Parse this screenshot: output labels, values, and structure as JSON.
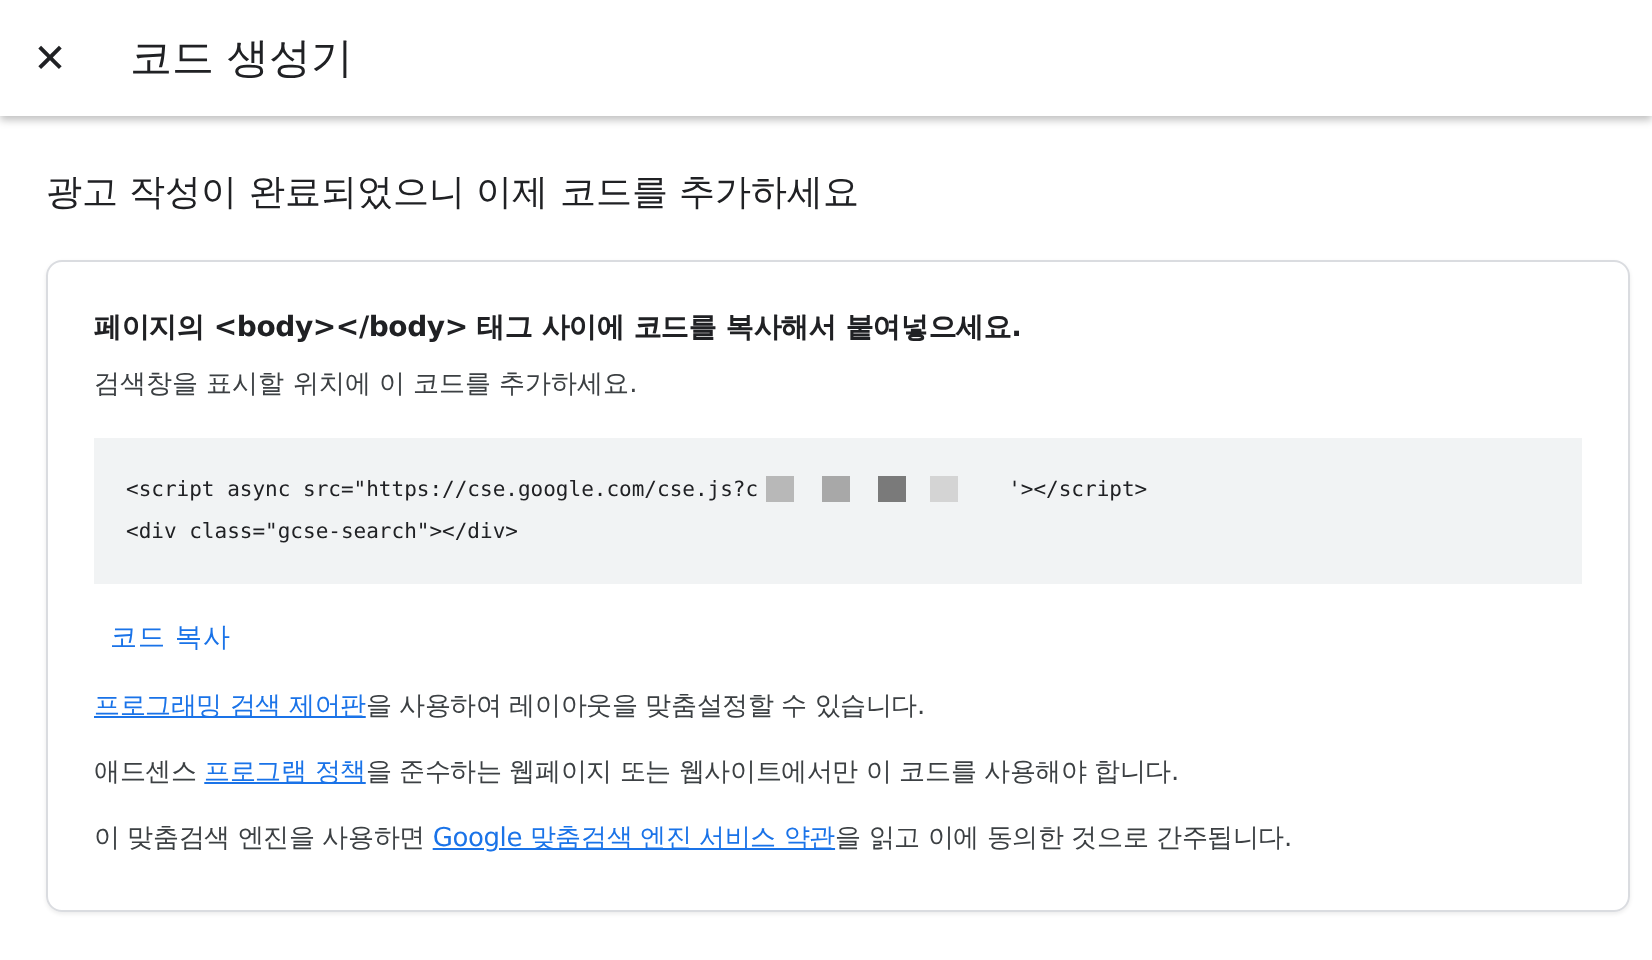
{
  "header": {
    "close_glyph": "✕",
    "title": "코드 생성기"
  },
  "heading": "광고 작성이 완료되었으니 이제 코드를 추가하세요",
  "card": {
    "instruction": "페이지의 <body></body> 태그 사이에 코드를 복사해서 붙여넣으세요.",
    "subtext": "검색창을 표시할 위치에 이 코드를 추가하세요.",
    "code_lines": [
      {
        "before": "<script async src=\"https://cse.google.com/cse.js?c",
        "redacted": true,
        "after": "'></script>"
      },
      {
        "before": "<div class=\"gcse-search\"></div>",
        "redacted": false
      }
    ],
    "copy_button": "코드 복사",
    "notes": [
      [
        {
          "text": "프로그래밍 검색 제어판",
          "link": true
        },
        {
          "text": "을 사용하여 레이아웃을 맞춤설정할 수 있습니다.",
          "link": false
        }
      ],
      [
        {
          "text": "애드센스 ",
          "link": false
        },
        {
          "text": "프로그램 정책",
          "link": true
        },
        {
          "text": "을 준수하는 웹페이지 또는 웹사이트에서만 이 코드를 사용해야 합니다.",
          "link": false
        }
      ],
      [
        {
          "text": "이 맞춤검색 엔진을 사용하면 ",
          "link": false
        },
        {
          "text": "Google 맞춤검색 엔진 서비스 약관",
          "link": true
        },
        {
          "text": "을 읽고 이에 동의한 것으로 간주됩니다.",
          "link": false
        }
      ]
    ]
  }
}
